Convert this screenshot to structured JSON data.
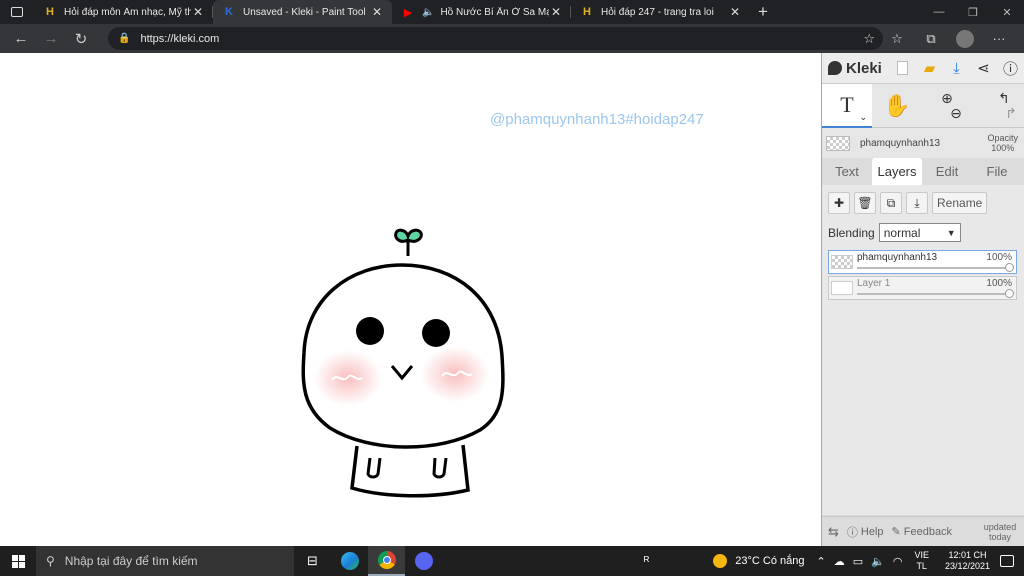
{
  "browser": {
    "tabs": [
      {
        "title": "Hỏi đáp môn Âm nhạc, Mỹ thuật",
        "favicon": "H",
        "favicon_color": "#e3b21d"
      },
      {
        "title": "Unsaved - Kleki - Paint Tool",
        "favicon": "K",
        "favicon_color": "#2d6fd8"
      },
      {
        "title": "Hồ Nước Bí Ẩn Ở Sa Mạc Như",
        "favicon": "▶",
        "favicon_color": "#ff0000"
      },
      {
        "title": "Hỏi đáp 247 - trang tra loi",
        "favicon": "H",
        "favicon_color": "#e3b21d"
      }
    ],
    "close_glyph": "✕",
    "new_tab_glyph": "+",
    "url": "https://kleki.com",
    "window_controls": [
      "—",
      "❐",
      "✕"
    ]
  },
  "canvas": {
    "watermark": "@phamquynhanh13#hoidap247"
  },
  "kleki": {
    "app_name": "Kleki",
    "layer_name": "phamquynhanh13",
    "opacity_label": "Opacity",
    "opacity_value": "100%",
    "tabs": [
      "Text",
      "Layers",
      "Edit",
      "File"
    ],
    "active_tab": "Layers",
    "rename_label": "Rename",
    "blending_label": "Blending",
    "blending_value": "normal",
    "layers": [
      {
        "name": "phamquynhanh13",
        "opacity": "100%",
        "selected": true
      },
      {
        "name": "Layer 1",
        "opacity": "100%",
        "selected": false
      }
    ],
    "bottom": {
      "help": "Help",
      "feedback": "Feedback",
      "updated": "updated today"
    }
  },
  "taskbar": {
    "search_placeholder": "Nhập tại đây để tìm kiếm",
    "weather": "23°C  Có nắng",
    "lang_top": "VIE",
    "lang_bottom": "TL",
    "time": "12:01 CH",
    "date": "23/12/2021"
  },
  "colors": {
    "accent": "#4285d6",
    "watermark": "#9cc6ee",
    "sprout": "#5fd6a4"
  }
}
